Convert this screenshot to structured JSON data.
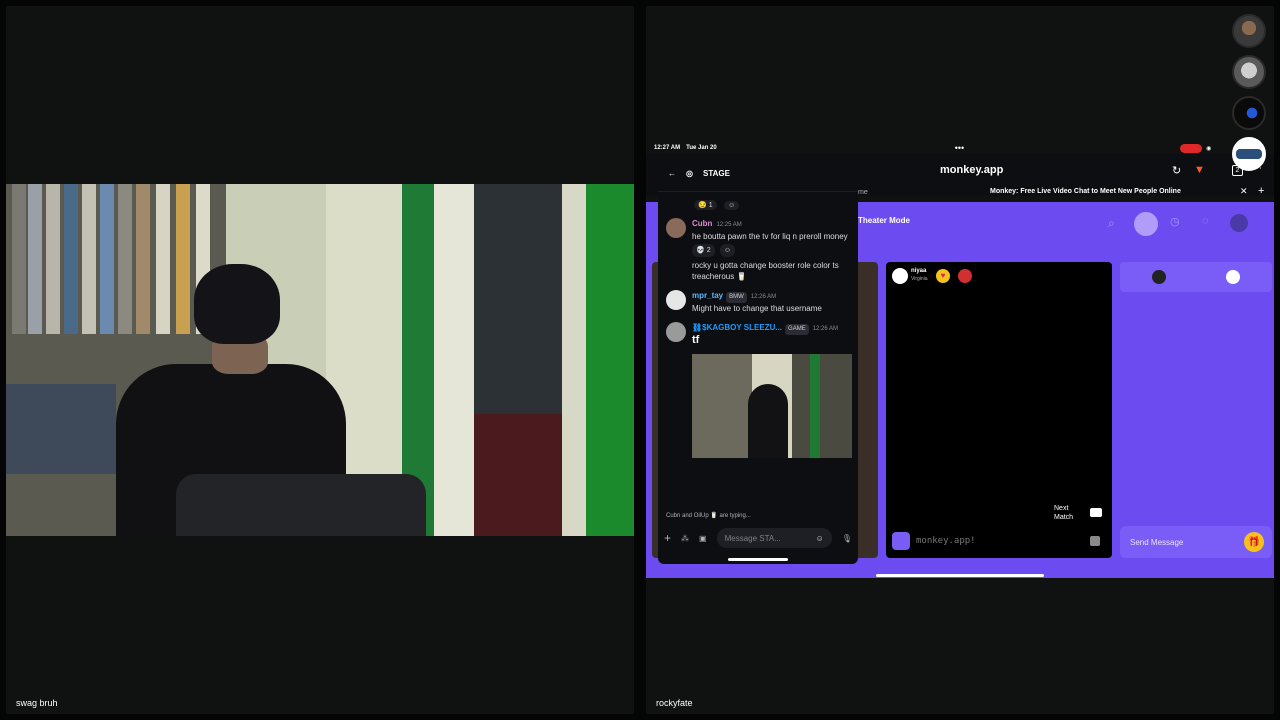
{
  "left_tile": {
    "name": "swag bruh"
  },
  "right_tile": {
    "name": "rockyfate"
  },
  "status_bar": {
    "time": "12:27 AM",
    "date": "Tue Jan 20"
  },
  "browser": {
    "url": "monkey.app",
    "tab_title": "Monkey: Free Live Video Chat to Meet New People Online",
    "partial_tab": "me",
    "tab_count": "2"
  },
  "discord": {
    "channel": "STAGE",
    "top_reaction": "1",
    "messages": [
      {
        "author": "Cubn",
        "time": "12:25 AM",
        "text": "he boutta pawn the tv for liq n preroll money",
        "reaction_count": "2",
        "author_color": "#e08ad8"
      },
      {
        "author": "",
        "time": "",
        "text": "rocky u gotta change booster role color ts treacherous 🥛",
        "author_color": "#ffffff"
      },
      {
        "author": "mpr_tay",
        "tag": "BMW",
        "time": "12:26 AM",
        "text": "Might have to change that username",
        "author_color": "#5bb8ff"
      },
      {
        "author": "⛓$KAGBOY SLEEZU...",
        "tag": "GAME",
        "time": "12:26 AM",
        "text": "tf",
        "author_color": "#1e9bff"
      }
    ],
    "typing": "Cubn and OilUp 🥛 are typing...",
    "compose_placeholder": "Message STA..."
  },
  "monkey": {
    "theater_mode": "Theater Mode",
    "match_name": "niyaa",
    "match_location": "Virginia",
    "next_match": "Next Match",
    "watermark": "monkey.app!",
    "send_message": "Send Message"
  }
}
